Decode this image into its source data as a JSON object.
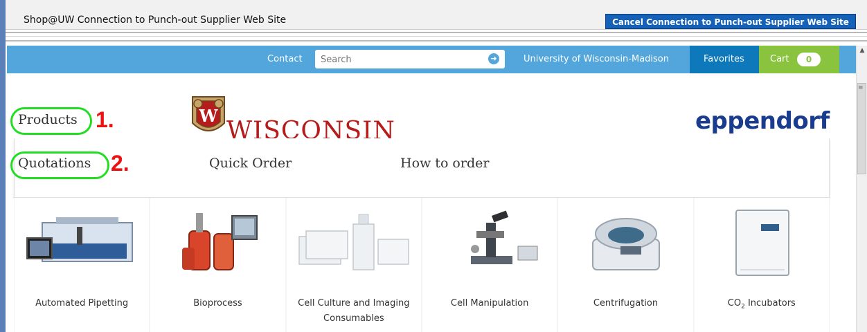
{
  "punchout": {
    "title": "Shop@UW Connection to Punch-out Supplier Web Site",
    "cancel_label": "Cancel Connection to Punch-out Supplier Web Site"
  },
  "topnav": {
    "contact": "Contact",
    "search_placeholder": "Search",
    "university": "University of Wisconsin-Madison",
    "favorites": "Favorites",
    "cart_label": "Cart",
    "cart_count": "0"
  },
  "header": {
    "uw_wordmark": "WISCONSIN",
    "uw_crest_letter": "W",
    "brand": "eppendorf"
  },
  "menu": {
    "products": "Products",
    "quotations": "Quotations",
    "quick_order": "Quick Order",
    "how_to_order": "How to order"
  },
  "annotations": {
    "num_1": "1.",
    "num_2": "2."
  },
  "categories": [
    {
      "label": "Automated Pipetting",
      "icon": "pipetting-robot-image"
    },
    {
      "label": "Bioprocess",
      "icon": "bioreactor-image"
    },
    {
      "label": "Cell Culture and Imaging Consumables",
      "icon": "cell-culture-flasks-image"
    },
    {
      "label": "Cell Manipulation",
      "icon": "microscope-image"
    },
    {
      "label": "Centrifugation",
      "icon": "centrifuge-image"
    },
    {
      "label_main": "CO",
      "label_sub": "2",
      "label_rest": " Incubators",
      "icon": "incubator-image"
    }
  ],
  "colors": {
    "nav_blue": "#52a6dc",
    "favorites_blue": "#0e79ba",
    "cart_green": "#8ac43f",
    "cancel_blue": "#1561b8",
    "annotation_green": "#22dd22",
    "annotation_red": "#ee1111"
  }
}
